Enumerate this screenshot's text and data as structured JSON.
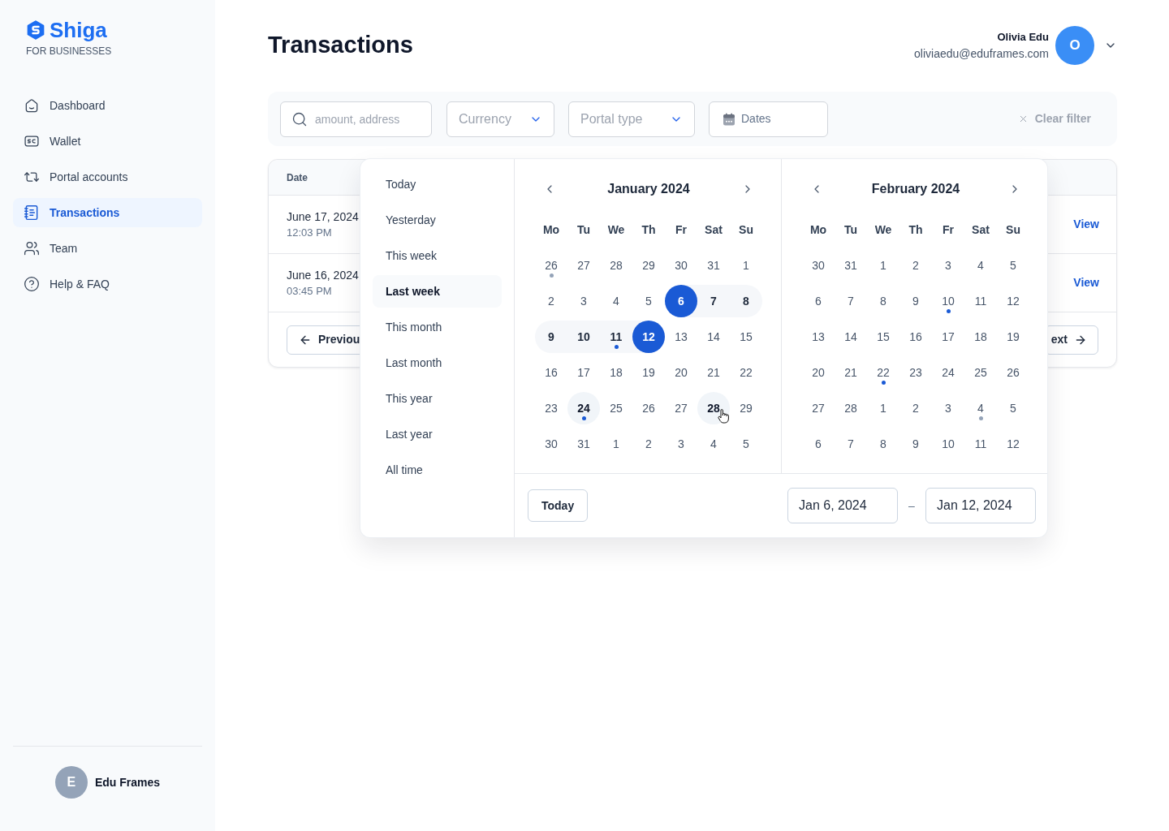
{
  "sidebar": {
    "logo": {
      "name": "Shiga",
      "tagline": "FOR BUSINESSES"
    },
    "items": [
      {
        "label": "Dashboard",
        "selected": false
      },
      {
        "label": "Wallet",
        "selected": false
      },
      {
        "label": "Portal accounts",
        "selected": false
      },
      {
        "label": "Transactions",
        "selected": true
      },
      {
        "label": "Team",
        "selected": false
      },
      {
        "label": "Help & FAQ",
        "selected": false
      }
    ],
    "account": {
      "initial": "E",
      "name": "Edu Frames"
    }
  },
  "header": {
    "title": "Transactions",
    "user": {
      "name": "Olivia Edu",
      "email": "oliviaedu@eduframes.com",
      "initial": "O"
    }
  },
  "filters": {
    "search": {
      "placeholder": "amount, address"
    },
    "currency": {
      "placeholder": "Currency"
    },
    "portal_type": {
      "placeholder": "Portal type"
    },
    "dates": {
      "label": "Dates"
    },
    "clear": "Clear filter"
  },
  "table": {
    "columns": [
      "Date"
    ],
    "rows": [
      {
        "date": "June 17, 2024",
        "time": "12:03 PM",
        "action": "View"
      },
      {
        "date": "June 16, 2024",
        "time": "03:45 PM",
        "action": "View"
      }
    ],
    "pagination": {
      "previous": "Previou",
      "next": "ext"
    }
  },
  "date_picker": {
    "presets": [
      {
        "label": "Today",
        "selected": false
      },
      {
        "label": "Yesterday",
        "selected": false
      },
      {
        "label": "This week",
        "selected": false
      },
      {
        "label": "Last week",
        "selected": true
      },
      {
        "label": "This month",
        "selected": false
      },
      {
        "label": "Last month",
        "selected": false
      },
      {
        "label": "This year",
        "selected": false
      },
      {
        "label": "Last year",
        "selected": false
      },
      {
        "label": "All time",
        "selected": false
      }
    ],
    "months": [
      {
        "title": "January 2024",
        "weekdays": [
          "Mo",
          "Tu",
          "We",
          "Th",
          "Fr",
          "Sat",
          "Su"
        ],
        "days": [
          {
            "label": "26",
            "selected": false,
            "in_range": false,
            "today": false,
            "hovered": false,
            "color": "#94a3b8"
          },
          {
            "label": "27",
            "selected": false,
            "in_range": false,
            "today": false,
            "hovered": false
          },
          {
            "label": "28",
            "selected": false,
            "in_range": false,
            "today": false,
            "hovered": false
          },
          {
            "label": "29",
            "selected": false,
            "in_range": false,
            "today": false,
            "hovered": false
          },
          {
            "label": "30",
            "selected": false,
            "in_range": false,
            "today": false,
            "hovered": false
          },
          {
            "label": "31",
            "selected": false,
            "in_range": false,
            "today": false,
            "hovered": false
          },
          {
            "label": "1",
            "selected": false,
            "in_range": false,
            "today": false,
            "hovered": false
          },
          {
            "label": "2",
            "selected": false,
            "in_range": false,
            "today": false,
            "hovered": false
          },
          {
            "label": "3",
            "selected": false,
            "in_range": false,
            "today": false,
            "hovered": false
          },
          {
            "label": "4",
            "selected": false,
            "in_range": false,
            "today": false,
            "hovered": false
          },
          {
            "label": "5",
            "selected": false,
            "in_range": false,
            "today": false,
            "hovered": false
          },
          {
            "label": "6",
            "selected": true,
            "in_range": false,
            "today": false,
            "hovered": false
          },
          {
            "label": "7",
            "selected": false,
            "in_range": true,
            "today": false,
            "hovered": false
          },
          {
            "label": "8",
            "selected": false,
            "in_range": true,
            "today": false,
            "hovered": false
          },
          {
            "label": "9",
            "selected": false,
            "in_range": true,
            "today": false,
            "hovered": false
          },
          {
            "label": "10",
            "selected": false,
            "in_range": true,
            "today": false,
            "hovered": false
          },
          {
            "label": "11",
            "selected": false,
            "in_range": true,
            "today": false,
            "hovered": false,
            "color": "#1a5ad5"
          },
          {
            "label": "12",
            "selected": true,
            "in_range": false,
            "today": false,
            "hovered": false
          },
          {
            "label": "13",
            "selected": false,
            "in_range": false,
            "today": false,
            "hovered": false
          },
          {
            "label": "14",
            "selected": false,
            "in_range": false,
            "today": false,
            "hovered": false
          },
          {
            "label": "15",
            "selected": false,
            "in_range": false,
            "today": false,
            "hovered": false
          },
          {
            "label": "16",
            "selected": false,
            "in_range": false,
            "today": false,
            "hovered": false
          },
          {
            "label": "17",
            "selected": false,
            "in_range": false,
            "today": false,
            "hovered": false
          },
          {
            "label": "18",
            "selected": false,
            "in_range": false,
            "today": false,
            "hovered": false
          },
          {
            "label": "19",
            "selected": false,
            "in_range": false,
            "today": false,
            "hovered": false
          },
          {
            "label": "20",
            "selected": false,
            "in_range": false,
            "today": false,
            "hovered": false
          },
          {
            "label": "21",
            "selected": false,
            "in_range": false,
            "today": false,
            "hovered": false
          },
          {
            "label": "22",
            "selected": false,
            "in_range": false,
            "today": false,
            "hovered": false
          },
          {
            "label": "23",
            "selected": false,
            "in_range": false,
            "today": false,
            "hovered": false
          },
          {
            "label": "24",
            "selected": false,
            "in_range": false,
            "today": true,
            "hovered": false,
            "color": "#1a5ad5"
          },
          {
            "label": "25",
            "selected": false,
            "in_range": false,
            "today": false,
            "hovered": false
          },
          {
            "label": "26",
            "selected": false,
            "in_range": false,
            "today": false,
            "hovered": false
          },
          {
            "label": "27",
            "selected": false,
            "in_range": false,
            "today": false,
            "hovered": false
          },
          {
            "label": "28",
            "selected": false,
            "in_range": false,
            "today": false,
            "hovered": true
          },
          {
            "label": "29",
            "selected": false,
            "in_range": false,
            "today": false,
            "hovered": false
          },
          {
            "label": "30",
            "selected": false,
            "in_range": false,
            "today": false,
            "hovered": false
          },
          {
            "label": "31",
            "selected": false,
            "in_range": false,
            "today": false,
            "hovered": false
          },
          {
            "label": "1",
            "selected": false,
            "in_range": false,
            "today": false,
            "hovered": false
          },
          {
            "label": "2",
            "selected": false,
            "in_range": false,
            "today": false,
            "hovered": false
          },
          {
            "label": "3",
            "selected": false,
            "in_range": false,
            "today": false,
            "hovered": false
          },
          {
            "label": "4",
            "selected": false,
            "in_range": false,
            "today": false,
            "hovered": false
          },
          {
            "label": "5",
            "selected": false,
            "in_range": false,
            "today": false,
            "hovered": false
          }
        ]
      },
      {
        "title": "February 2024",
        "weekdays": [
          "Mo",
          "Tu",
          "We",
          "Th",
          "Fr",
          "Sat",
          "Su"
        ],
        "days": [
          {
            "label": "30",
            "selected": false,
            "in_range": false,
            "today": false,
            "hovered": false
          },
          {
            "label": "31",
            "selected": false,
            "in_range": false,
            "today": false,
            "hovered": false
          },
          {
            "label": "1",
            "selected": false,
            "in_range": false,
            "today": false,
            "hovered": false
          },
          {
            "label": "2",
            "selected": false,
            "in_range": false,
            "today": false,
            "hovered": false
          },
          {
            "label": "3",
            "selected": false,
            "in_range": false,
            "today": false,
            "hovered": false
          },
          {
            "label": "4",
            "selected": false,
            "in_range": false,
            "today": false,
            "hovered": false
          },
          {
            "label": "5",
            "selected": false,
            "in_range": false,
            "today": false,
            "hovered": false
          },
          {
            "label": "6",
            "selected": false,
            "in_range": false,
            "today": false,
            "hovered": false
          },
          {
            "label": "7",
            "selected": false,
            "in_range": false,
            "today": false,
            "hovered": false
          },
          {
            "label": "8",
            "selected": false,
            "in_range": false,
            "today": false,
            "hovered": false
          },
          {
            "label": "9",
            "selected": false,
            "in_range": false,
            "today": false,
            "hovered": false
          },
          {
            "label": "10",
            "selected": false,
            "in_range": false,
            "today": false,
            "hovered": false,
            "color": "#1a5ad5"
          },
          {
            "label": "11",
            "selected": false,
            "in_range": false,
            "today": false,
            "hovered": false
          },
          {
            "label": "12",
            "selected": false,
            "in_range": false,
            "today": false,
            "hovered": false
          },
          {
            "label": "13",
            "selected": false,
            "in_range": false,
            "today": false,
            "hovered": false
          },
          {
            "label": "14",
            "selected": false,
            "in_range": false,
            "today": false,
            "hovered": false
          },
          {
            "label": "15",
            "selected": false,
            "in_range": false,
            "today": false,
            "hovered": false
          },
          {
            "label": "16",
            "selected": false,
            "in_range": false,
            "today": false,
            "hovered": false
          },
          {
            "label": "17",
            "selected": false,
            "in_range": false,
            "today": false,
            "hovered": false
          },
          {
            "label": "18",
            "selected": false,
            "in_range": false,
            "today": false,
            "hovered": false
          },
          {
            "label": "19",
            "selected": false,
            "in_range": false,
            "today": false,
            "hovered": false
          },
          {
            "label": "20",
            "selected": false,
            "in_range": false,
            "today": false,
            "hovered": false
          },
          {
            "label": "21",
            "selected": false,
            "in_range": false,
            "today": false,
            "hovered": false
          },
          {
            "label": "22",
            "selected": false,
            "in_range": false,
            "today": false,
            "hovered": false,
            "color": "#1a5ad5"
          },
          {
            "label": "23",
            "selected": false,
            "in_range": false,
            "today": false,
            "hovered": false
          },
          {
            "label": "24",
            "selected": false,
            "in_range": false,
            "today": false,
            "hovered": false
          },
          {
            "label": "25",
            "selected": false,
            "in_range": false,
            "today": false,
            "hovered": false
          },
          {
            "label": "26",
            "selected": false,
            "in_range": false,
            "today": false,
            "hovered": false
          },
          {
            "label": "27",
            "selected": false,
            "in_range": false,
            "today": false,
            "hovered": false
          },
          {
            "label": "28",
            "selected": false,
            "in_range": false,
            "today": false,
            "hovered": false
          },
          {
            "label": "1",
            "selected": false,
            "in_range": false,
            "today": false,
            "hovered": false
          },
          {
            "label": "2",
            "selected": false,
            "in_range": false,
            "today": false,
            "hovered": false
          },
          {
            "label": "3",
            "selected": false,
            "in_range": false,
            "today": false,
            "hovered": false
          },
          {
            "label": "4",
            "selected": false,
            "in_range": false,
            "today": false,
            "hovered": false,
            "color": "#94a3b8"
          },
          {
            "label": "5",
            "selected": false,
            "in_range": false,
            "today": false,
            "hovered": false
          },
          {
            "label": "6",
            "selected": false,
            "in_range": false,
            "today": false,
            "hovered": false
          },
          {
            "label": "7",
            "selected": false,
            "in_range": false,
            "today": false,
            "hovered": false
          },
          {
            "label": "8",
            "selected": false,
            "in_range": false,
            "today": false,
            "hovered": false
          },
          {
            "label": "9",
            "selected": false,
            "in_range": false,
            "today": false,
            "hovered": false
          },
          {
            "label": "10",
            "selected": false,
            "in_range": false,
            "today": false,
            "hovered": false
          },
          {
            "label": "11",
            "selected": false,
            "in_range": false,
            "today": false,
            "hovered": false
          },
          {
            "label": "12",
            "selected": false,
            "in_range": false,
            "today": false,
            "hovered": false
          }
        ]
      }
    ],
    "footer": {
      "today_button": "Today",
      "start": "Jan 6, 2024",
      "separator": "–",
      "end": "Jan 12, 2024"
    }
  }
}
